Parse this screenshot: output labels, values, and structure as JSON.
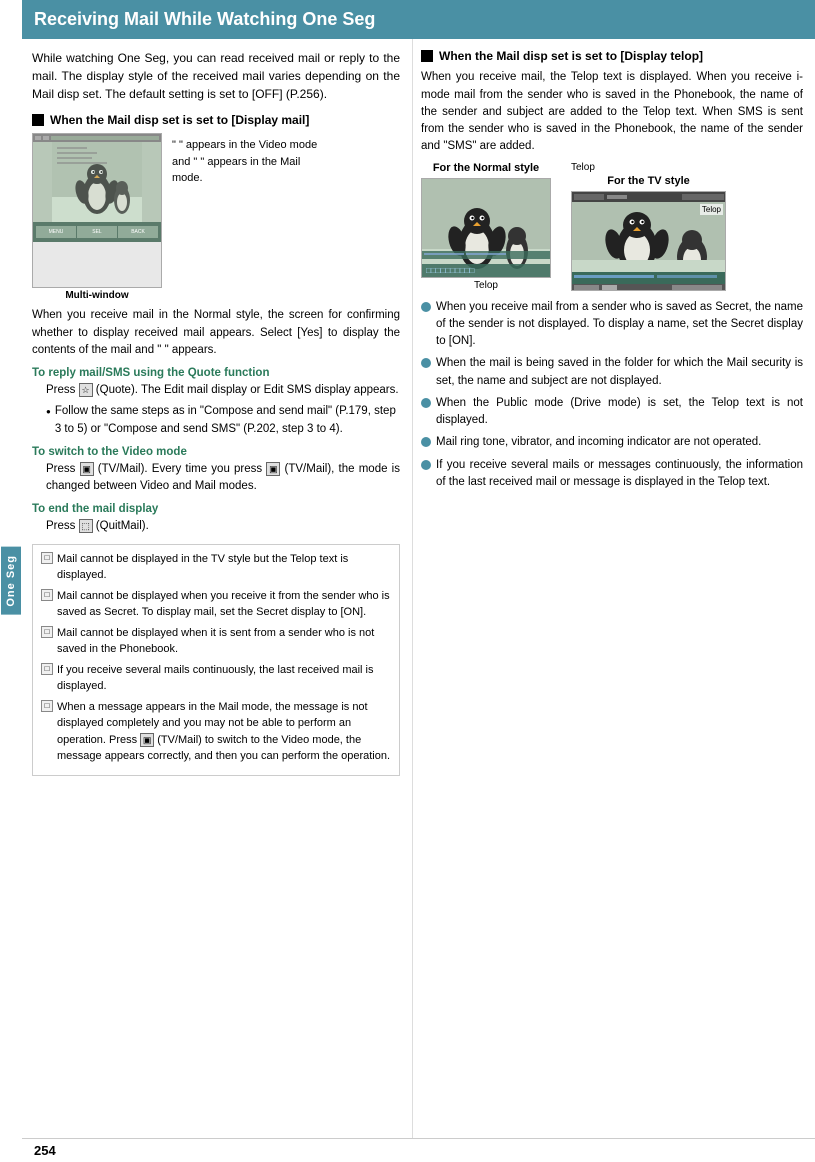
{
  "header": {
    "title": "Receiving Mail While Watching One Seg",
    "bg_color": "#4a90a4"
  },
  "sidebar": {
    "label": "One Seg"
  },
  "left_col": {
    "intro": "While watching One Seg, you can read received mail or reply to the mail. The display style of the received mail varies depending on the Mail disp set. The default setting is set to [OFF] (P.256).",
    "section1_heading": "When the Mail disp set is set to [Display mail]",
    "caption1": "\" \" appears in the Video mode and \" \" appears in the Mail mode.",
    "multiwindow_label": "Multi-window",
    "body1": "When you receive mail in the Normal style, the screen for confirming whether to display received mail appears. Select [Yes] to display the contents of the mail and \"  \" appears.",
    "teal1": "To reply mail/SMS using the Quote function",
    "indented1": "Press  (Quote). The Edit mail display or Edit SMS display appears.",
    "bullet1": "Follow the same steps as in \"Compose and send mail\" (P.179, step 3 to 5) or \"Compose and send SMS\" (P.202, step 3 to 4).",
    "teal2": "To switch to the Video mode",
    "indented2": "Press  (TV/Mail). Every time you press  (TV/Mail), the mode is changed between Video and Mail modes.",
    "teal3": "To end the mail display",
    "indented3": "Press  (QuitMail).",
    "notes": [
      "Mail cannot be displayed in the TV style but the Telop text is displayed.",
      "Mail cannot be displayed when you receive it from the sender who is saved as Secret. To display mail, set the Secret display to [ON].",
      "Mail cannot be displayed when it is sent from a sender who is not saved in the Phonebook.",
      "If you receive several mails continuously, the last received mail is displayed.",
      "When a message appears in the Mail mode, the message is not displayed completely and you may not be able to perform an operation. Press  (TV/Mail) to switch to the Video mode, the message appears correctly, and then you can perform the operation."
    ]
  },
  "right_col": {
    "section2_heading": "When the Mail disp set is set to [Display telop]",
    "body2": "When you receive mail, the Telop text is displayed. When you receive i-mode mail from the sender who is saved in the Phonebook, the name of the sender and subject are added to the Telop text. When SMS is sent from the sender who is saved in the Phonebook, the name of the sender and \"SMS\" are added.",
    "label_normal": "For the Normal style",
    "label_tv": "For the TV style",
    "telop_label1": "Telop",
    "telop_label2": "Telop",
    "bullets": [
      "When you receive mail from a sender who is saved as Secret, the name of the sender is not displayed. To display a name, set the Secret display to [ON].",
      "When the mail is being saved in the folder for which the Mail security is set, the name and subject are not displayed.",
      "When the Public mode (Drive mode) is set, the Telop text is not displayed.",
      "Mail ring tone, vibrator, and incoming indicator are not operated.",
      "If you receive several mails or messages continuously, the information of the last received mail or message is displayed in the Telop text."
    ]
  },
  "page_number": "254"
}
